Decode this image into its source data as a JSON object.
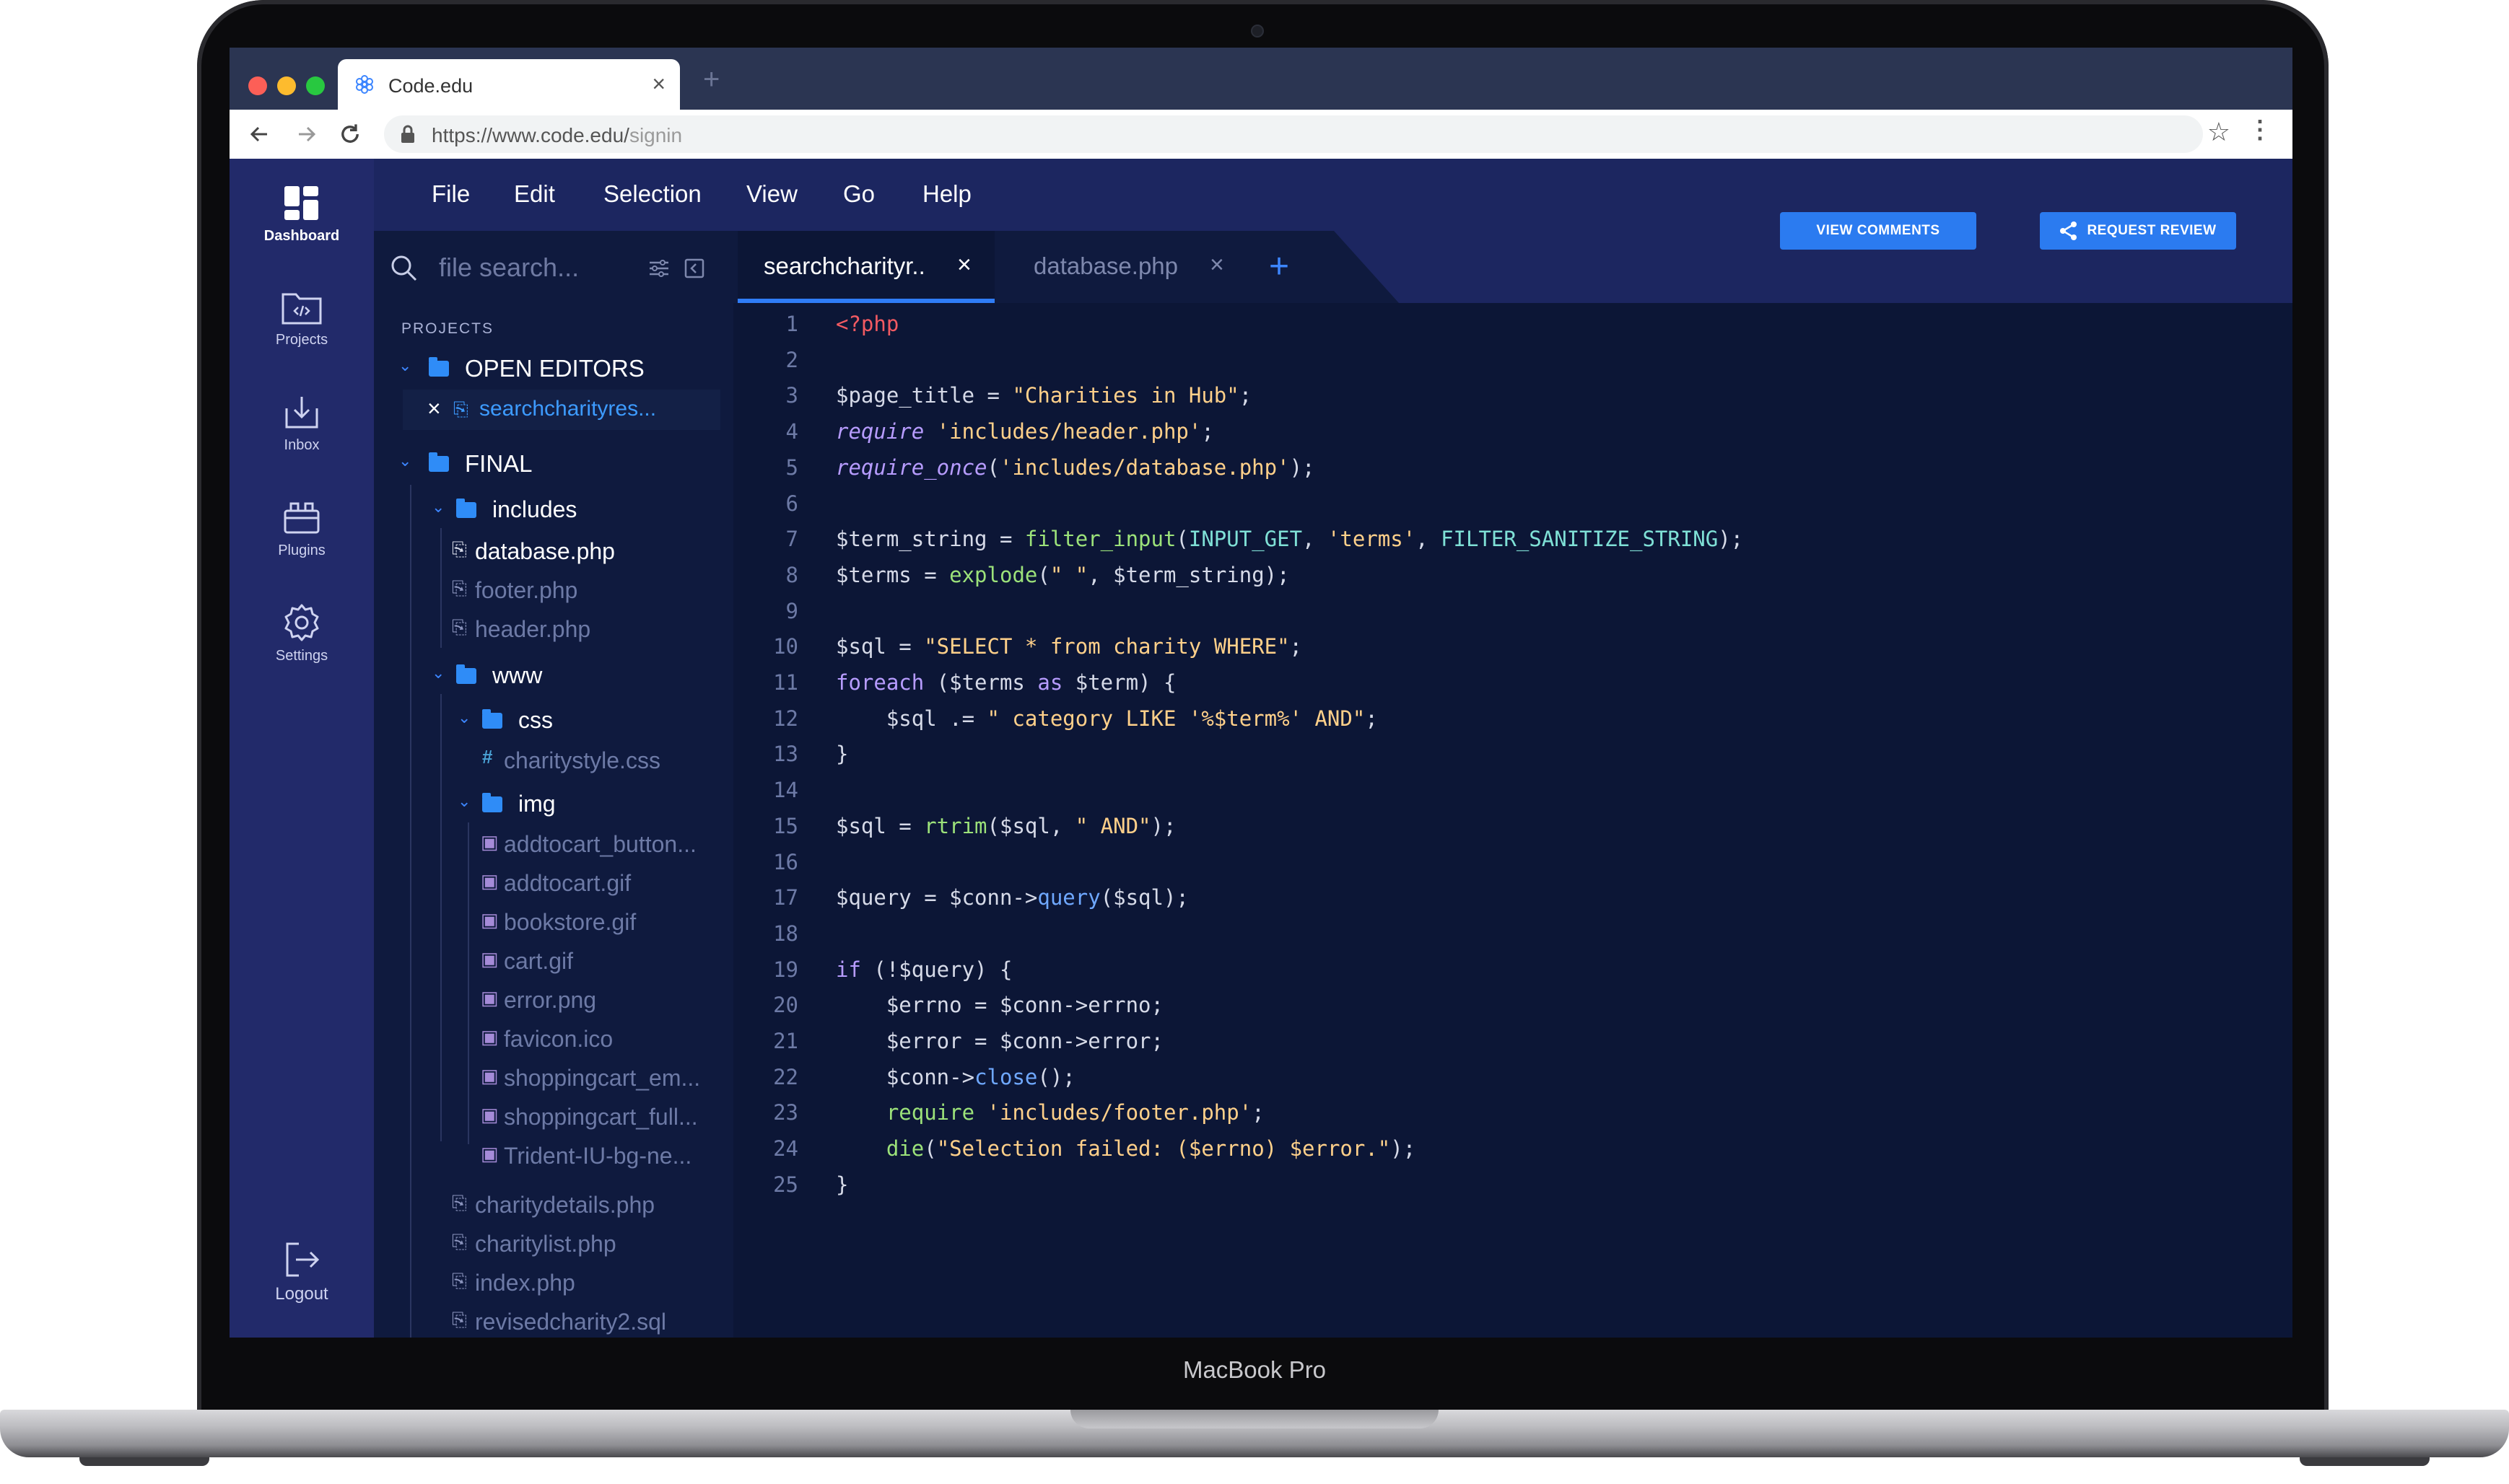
{
  "device": {
    "label": "MacBook Pro"
  },
  "browser": {
    "tab_title": "Code.edu",
    "tab_close": "×",
    "new_tab": "+",
    "url_main": "https://www.code.edu/",
    "url_path": "signin"
  },
  "rail": {
    "items": [
      {
        "label": "Dashboard",
        "icon": "dashboard-icon"
      },
      {
        "label": "Projects",
        "icon": "projects-folder-icon"
      },
      {
        "label": "Inbox",
        "icon": "inbox-icon"
      },
      {
        "label": "Plugins",
        "icon": "plugins-icon"
      },
      {
        "label": "Settings",
        "icon": "settings-gear-icon"
      }
    ],
    "logout": {
      "label": "Logout",
      "icon": "logout-icon"
    }
  },
  "menu": [
    "File",
    "Edit",
    "Selection",
    "View",
    "Go",
    "Help"
  ],
  "search": {
    "placeholder": "file search..."
  },
  "tabs": [
    {
      "name": "searchcharityr..",
      "close": "×",
      "active": true
    },
    {
      "name": "database.php",
      "close": "×",
      "active": false
    }
  ],
  "add_tab": "+",
  "buttons": {
    "view_comments": "VIEW COMMENTS",
    "request_review": "REQUEST REVIEW"
  },
  "sidebar": {
    "heading": "PROJECTS",
    "open_editors": {
      "label": "OPEN EDITORS",
      "files": [
        "searchcharityres..."
      ],
      "close": "×"
    },
    "project": "FINAL",
    "includes": {
      "label": "includes",
      "files": [
        "database.php",
        "footer.php",
        "header.php"
      ]
    },
    "www": {
      "label": "www"
    },
    "css": {
      "label": "css",
      "files": [
        "charitystyle.css"
      ]
    },
    "img": {
      "label": "img",
      "files": [
        "addtocart_button...",
        "addtocart.gif",
        "bookstore.gif",
        "cart.gif",
        "error.png",
        "favicon.ico",
        "shoppingcart_em...",
        "shoppingcart_full...",
        "Trident-IU-bg-ne..."
      ]
    },
    "root_files": [
      "charitydetails.php",
      "charitylist.php",
      "index.php",
      "revisedcharity2.sql"
    ]
  },
  "code": [
    [
      [
        "tag",
        "<?php"
      ]
    ],
    [],
    [
      [
        "var",
        "$page_title = "
      ],
      [
        "str",
        "\"Charities in Hub\""
      ],
      [
        "var",
        ";"
      ]
    ],
    [
      [
        "kw",
        "require"
      ],
      [
        "var",
        " "
      ],
      [
        "str",
        "'includes/header.php'"
      ],
      [
        "var",
        ";"
      ]
    ],
    [
      [
        "kw",
        "require_once"
      ],
      [
        "var",
        "("
      ],
      [
        "str",
        "'includes/database.php'"
      ],
      [
        "var",
        ");"
      ]
    ],
    [],
    [
      [
        "var",
        "$term_string = "
      ],
      [
        "fn",
        "filter_input"
      ],
      [
        "var",
        "("
      ],
      [
        "const",
        "INPUT_GET"
      ],
      [
        "var",
        ", "
      ],
      [
        "str",
        "'terms'"
      ],
      [
        "var",
        ", "
      ],
      [
        "const",
        "FILTER_SANITIZE_STRING"
      ],
      [
        "var",
        ");"
      ]
    ],
    [
      [
        "var",
        "$terms = "
      ],
      [
        "fn",
        "explode"
      ],
      [
        "var",
        "("
      ],
      [
        "str",
        "\" \""
      ],
      [
        "var",
        ", $term_string);"
      ]
    ],
    [],
    [
      [
        "var",
        "$sql = "
      ],
      [
        "str",
        "\"SELECT * from charity WHERE\""
      ],
      [
        "var",
        ";"
      ]
    ],
    [
      [
        "kw2",
        "foreach"
      ],
      [
        "var",
        " ($terms "
      ],
      [
        "kw2",
        "as"
      ],
      [
        "var",
        " $term) {"
      ]
    ],
    [
      [
        "var",
        "    $sql .= "
      ],
      [
        "str",
        "\" category LIKE '%$term%' AND\""
      ],
      [
        "var",
        ";"
      ]
    ],
    [
      [
        "var",
        "}"
      ]
    ],
    [],
    [
      [
        "var",
        "$sql = "
      ],
      [
        "fn",
        "rtrim"
      ],
      [
        "var",
        "($sql, "
      ],
      [
        "str",
        "\" AND\""
      ],
      [
        "var",
        ");"
      ]
    ],
    [],
    [
      [
        "var",
        "$query = $conn->"
      ],
      [
        "meth",
        "query"
      ],
      [
        "var",
        "($sql);"
      ]
    ],
    [],
    [
      [
        "kw2",
        "if"
      ],
      [
        "var",
        " (!$query) {"
      ]
    ],
    [
      [
        "var",
        "    $errno = $conn->errno;"
      ]
    ],
    [
      [
        "var",
        "    $error = $conn->error;"
      ]
    ],
    [
      [
        "var",
        "    $conn->"
      ],
      [
        "meth",
        "close"
      ],
      [
        "var",
        "();"
      ]
    ],
    [
      [
        "var",
        "    "
      ],
      [
        "fn",
        "require"
      ],
      [
        "var",
        " "
      ],
      [
        "str",
        "'includes/footer.php'"
      ],
      [
        "var",
        ";"
      ]
    ],
    [
      [
        "var",
        "    "
      ],
      [
        "fn",
        "die"
      ],
      [
        "var",
        "("
      ],
      [
        "str",
        "\"Selection failed: ($errno) $error.\""
      ],
      [
        "var",
        ");"
      ]
    ],
    [
      [
        "var",
        "}"
      ]
    ]
  ],
  "colors": {
    "rail": "#222a6a",
    "menubar": "#1c2660",
    "editor_bg": "#0c1636",
    "accent": "#2b7bf0"
  }
}
